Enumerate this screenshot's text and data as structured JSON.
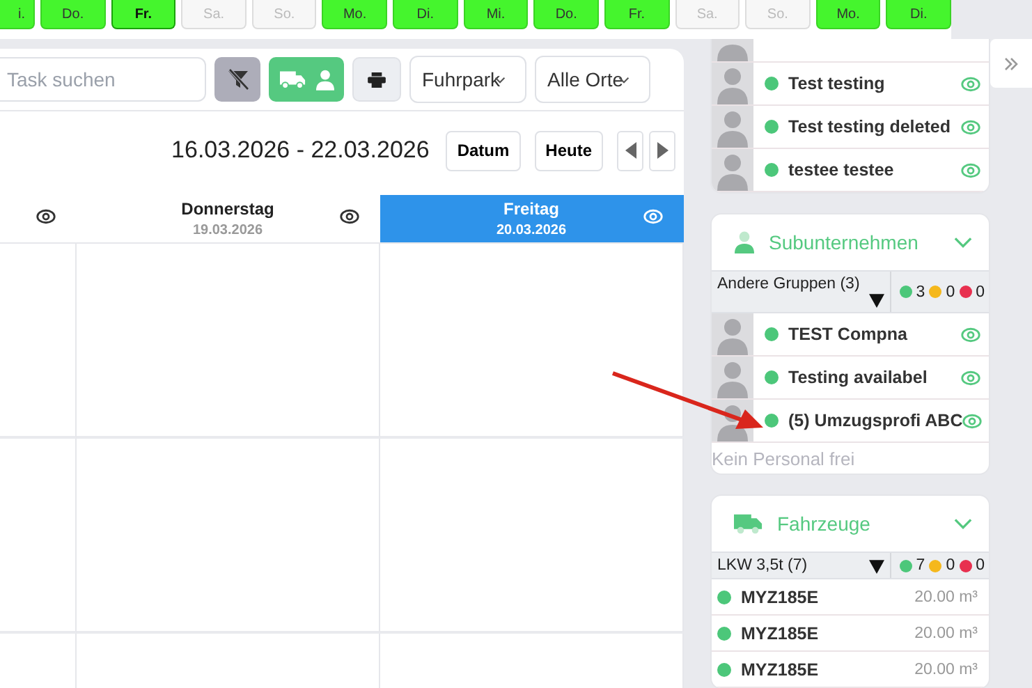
{
  "day_chips": [
    {
      "label": "i.",
      "selected": false,
      "disabled": false
    },
    {
      "label": "Do.",
      "selected": false,
      "disabled": false
    },
    {
      "label": "Fr.",
      "selected": true,
      "disabled": false
    },
    {
      "label": "Sa.",
      "selected": false,
      "disabled": true
    },
    {
      "label": "So.",
      "selected": false,
      "disabled": true
    },
    {
      "label": "Mo.",
      "selected": false,
      "disabled": false
    },
    {
      "label": "Di.",
      "selected": false,
      "disabled": false
    },
    {
      "label": "Mi.",
      "selected": false,
      "disabled": false
    },
    {
      "label": "Do.",
      "selected": false,
      "disabled": false
    },
    {
      "label": "Fr.",
      "selected": false,
      "disabled": false
    },
    {
      "label": "Sa.",
      "selected": false,
      "disabled": true
    },
    {
      "label": "So.",
      "selected": false,
      "disabled": true
    },
    {
      "label": "Mo.",
      "selected": false,
      "disabled": false
    },
    {
      "label": "Di.",
      "selected": false,
      "disabled": false
    }
  ],
  "toolbar": {
    "search": {
      "placeholder": "Task suchen"
    },
    "vehicle_person_toggle": {
      "on": true
    },
    "selects": [
      "Fuhrpark",
      "Alle Orte"
    ]
  },
  "date_range": "16.03.2026 - 22.03.2026",
  "date_buttons": [
    "Datum",
    "Heute"
  ],
  "columns": [
    {
      "selected": false
    },
    {
      "title": "Donnerstag",
      "date": "19.03.2026",
      "selected": false
    },
    {
      "title": "Freitag",
      "date": "20.03.2026",
      "selected": true
    }
  ],
  "personnel": {
    "rows": [
      {
        "name": "Test testing",
        "color": "#4cc77a"
      },
      {
        "name": "Test testing deleted",
        "color": "#4cc77a"
      },
      {
        "name": "testee testee",
        "color": "#4cc77a"
      }
    ]
  },
  "subcontractors": {
    "title": "Subunternehmen",
    "group": {
      "label": "Andere Gruppen (3)",
      "counts": [
        {
          "value": "3",
          "color": "#4cc77a"
        },
        {
          "value": "0",
          "color": "#f5b81c"
        },
        {
          "value": "0",
          "color": "#e8304f"
        }
      ]
    },
    "rows": [
      {
        "name": "TEST Compna",
        "color": "#4cc77a"
      },
      {
        "name": "Testing availabel",
        "color": "#4cc77a"
      },
      {
        "name": "(5) Umzugsprofi ABC",
        "color": "#4cc77a"
      }
    ],
    "empty_note": "Kein Personal frei"
  },
  "vehicles": {
    "title": "Fahrzeuge",
    "group": {
      "label": "LKW 3,5t (7)",
      "counts": [
        {
          "value": "7",
          "color": "#4cc77a"
        },
        {
          "value": "0",
          "color": "#f5b81c"
        },
        {
          "value": "0",
          "color": "#e8304f"
        }
      ]
    },
    "rows": [
      {
        "plate": "MYZ185E",
        "volume": "20.00 m³",
        "color": "#4cc77a"
      },
      {
        "plate": "MYZ185E",
        "volume": "20.00 m³",
        "color": "#4cc77a"
      },
      {
        "plate": "MYZ185E",
        "volume": "20.00 m³",
        "color": "#4cc77a"
      }
    ]
  }
}
